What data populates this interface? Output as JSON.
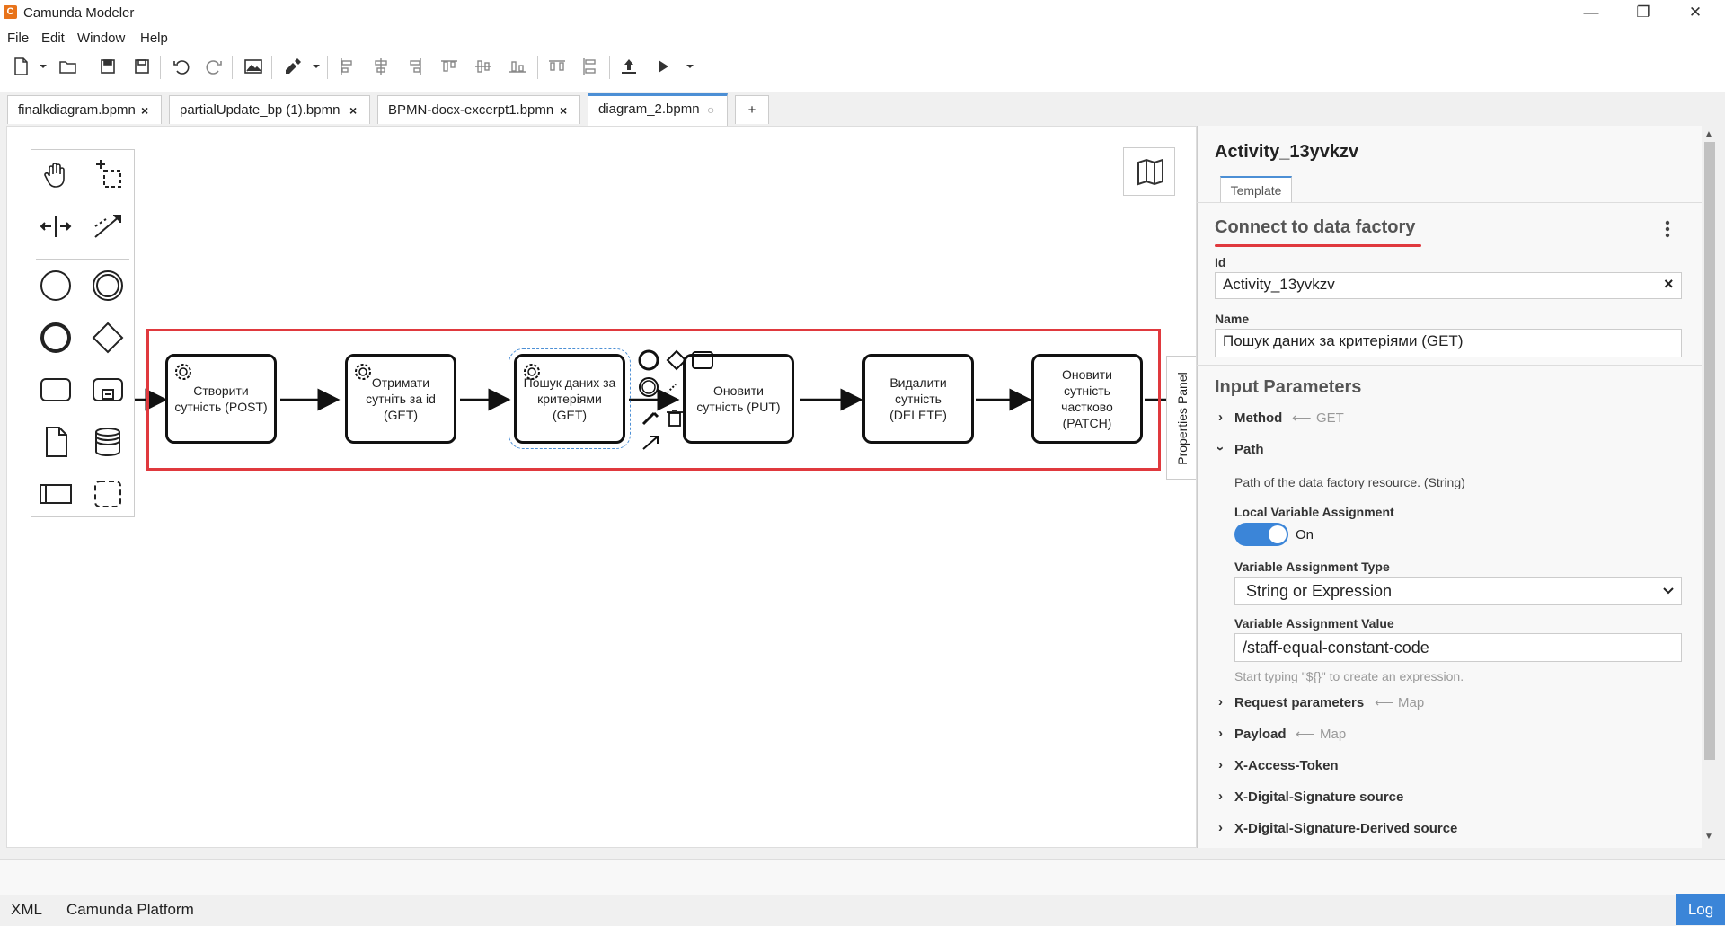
{
  "app": {
    "title": "Camunda Modeler",
    "icon_letter": "C"
  },
  "window_controls": {
    "minimize": "—",
    "restore": "❐",
    "close": "✕"
  },
  "menu": [
    "File",
    "Edit",
    "Window",
    "Help"
  ],
  "tabs": [
    {
      "label": "finalkdiagram.bpmn",
      "close": "×"
    },
    {
      "label": "partialUpdate_bp (1).bpmn",
      "close": "×"
    },
    {
      "label": "BPMN-docx-excerpt1.bpmn",
      "close": "×"
    },
    {
      "label": "diagram_2.bpmn",
      "close": "○",
      "active": true
    },
    {
      "label": "+"
    }
  ],
  "diagram": {
    "tasks": [
      {
        "label": "Створити сутність (POST)",
        "service": true
      },
      {
        "label": "Отримати сутніть за id (GET)",
        "service": true
      },
      {
        "label": "Пошук даних за критеріями (GET)",
        "service": true,
        "selected": true
      },
      {
        "label": "Оновити сутність (PUT)",
        "service": false
      },
      {
        "label": "Видалити сутність (DELETE)",
        "service": false
      },
      {
        "label": "Оновити сутність частково (PATCH)",
        "service": false
      }
    ],
    "properties_tab": "Properties Panel"
  },
  "panel": {
    "element_id": "Activity_13yvkzv",
    "tab": "Template",
    "template_name": "Connect to data factory",
    "id_label": "Id",
    "id_value": "Activity_13yvkzv",
    "clear": "×",
    "name_label": "Name",
    "name_value": "Пошук даних за критеріями (GET)",
    "input_params_title": "Input Parameters",
    "method": {
      "label": "Method",
      "value": "GET"
    },
    "path": {
      "label": "Path",
      "description": "Path of the data factory resource. (String)"
    },
    "local_var_label": "Local Variable Assignment",
    "toggle_state": "On",
    "var_type_label": "Variable Assignment Type",
    "var_type_value": "String or Expression",
    "var_value_label": "Variable Assignment Value",
    "var_value": "/staff-equal-constant-code",
    "hint": "Start typing \"${}\" to create an expression.",
    "groups": [
      {
        "label": "Request parameters",
        "value": "Map"
      },
      {
        "label": "Payload",
        "value": "Map"
      },
      {
        "label": "X-Access-Token",
        "value": ""
      },
      {
        "label": "X-Digital-Signature source",
        "value": ""
      },
      {
        "label": "X-Digital-Signature-Derived source",
        "value": ""
      }
    ],
    "group_arrow": "⟵"
  },
  "footer": {
    "xml": "XML",
    "platform": "Camunda Platform",
    "log": "Log"
  },
  "colors": {
    "accent": "#3b85d8",
    "highlight": "#e0393e",
    "app_icon": "#e8731a"
  }
}
